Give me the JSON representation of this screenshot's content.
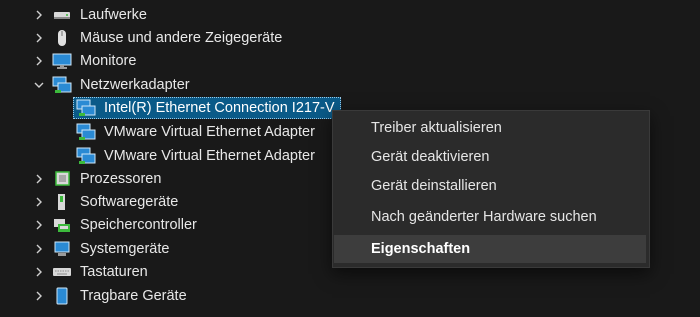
{
  "tree": {
    "items": [
      {
        "label": "Laufwerke",
        "icon": "drive-icon",
        "expanded": false
      },
      {
        "label": "Mäuse und andere Zeigegeräte",
        "icon": "mouse-icon",
        "expanded": false
      },
      {
        "label": "Monitore",
        "icon": "monitor-icon",
        "expanded": false
      },
      {
        "label": "Netzwerkadapter",
        "icon": "network-adapter-icon",
        "expanded": true
      },
      {
        "label": "Intel(R) Ethernet Connection I217-V",
        "icon": "network-adapter-icon",
        "selected": true
      },
      {
        "label": "VMware Virtual Ethernet Adapter",
        "icon": "network-adapter-icon"
      },
      {
        "label": "VMware Virtual Ethernet Adapter",
        "icon": "network-adapter-icon"
      },
      {
        "label": "Prozessoren",
        "icon": "processor-icon",
        "expanded": false
      },
      {
        "label": "Softwaregeräte",
        "icon": "software-device-icon",
        "expanded": false
      },
      {
        "label": "Speichercontroller",
        "icon": "storage-controller-icon",
        "expanded": false
      },
      {
        "label": "Systemgeräte",
        "icon": "system-device-icon",
        "expanded": false
      },
      {
        "label": "Tastaturen",
        "icon": "keyboard-icon",
        "expanded": false
      },
      {
        "label": "Tragbare Geräte",
        "icon": "portable-device-icon",
        "expanded": false
      }
    ]
  },
  "context_menu": {
    "items": [
      {
        "label": "Treiber aktualisieren"
      },
      {
        "label": "Gerät deaktivieren"
      },
      {
        "label": "Gerät deinstallieren"
      },
      {
        "label": "Nach geänderter Hardware suchen"
      },
      {
        "label": "Eigenschaften",
        "default": true,
        "highlighted": true
      }
    ]
  },
  "colors": {
    "background": "#191919",
    "selection": "#0a5a88",
    "menu_background": "#2b2b2b",
    "menu_highlight": "#3d3d3d"
  }
}
